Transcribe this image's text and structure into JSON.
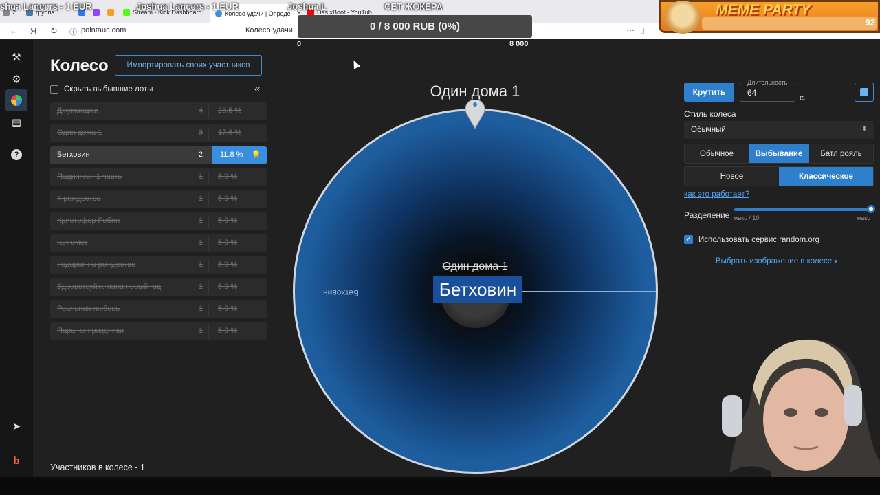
{
  "browser": {
    "tabs": [
      {
        "label": "2",
        "color": "#888"
      },
      {
        "label": "группа 1",
        "color": "#4a76a8"
      },
      {
        "label": "",
        "color": "#2c7be5"
      },
      {
        "label": "",
        "color": "#9146ff"
      },
      {
        "label": "",
        "color": "#f59d2a"
      },
      {
        "label": "Stream - Kick Dashboard",
        "color": "#53fc18"
      },
      {
        "label": "Колесо удачи | Опреде",
        "color": "#3a8ee0"
      },
      {
        "label": "Das xBoot - YouTub",
        "color": "#ff0000"
      }
    ],
    "url": "pointauc.com",
    "page_title": "Колесо удачи | О"
  },
  "overlay": {
    "donor1": "shua Lancers - 1 EUR",
    "donor2": "Joshua Lancers - 1 EUR",
    "donor3": "Joshua L",
    "set_label": "СЕТ ЖОКЕРА",
    "goal": "0 / 8 000 RUB (0%)",
    "goal_min": "0",
    "goal_max": "8 000",
    "meme_title": "MEME PARTY",
    "meme_num": "92"
  },
  "sidebar": {
    "icons": [
      "gavel-icon",
      "gear-icon",
      "wheel-icon",
      "clipboard-icon",
      "help-icon",
      "telegram-icon",
      "boosty-icon"
    ]
  },
  "left": {
    "title": "Колесо",
    "import_label": "Импортировать своих участников",
    "hide_label": "Скрыть выбывшие лоты",
    "lots": [
      {
        "name": "Джуманджи",
        "count": "4",
        "pct": "23.5 %",
        "active": false
      },
      {
        "name": "Один дома 1",
        "count": "3",
        "pct": "17.6 %",
        "active": false
      },
      {
        "name": "Бетховин",
        "count": "2",
        "pct": "11.8 %",
        "active": true
      },
      {
        "name": "Падингтон 1 часть",
        "count": "1",
        "pct": "5.9 %",
        "active": false
      },
      {
        "name": "4 рождества",
        "count": "1",
        "pct": "5.9 %",
        "active": false
      },
      {
        "name": "Кристофер Робин",
        "count": "1",
        "pct": "5.9 %",
        "active": false
      },
      {
        "name": "галгомет",
        "count": "1",
        "pct": "5.9 %",
        "active": false
      },
      {
        "name": "подарок на рождество",
        "count": "1",
        "pct": "5.9 %",
        "active": false
      },
      {
        "name": "Здравствуйте папа новый год",
        "count": "1",
        "pct": "5.9 %",
        "active": false
      },
      {
        "name": "Реальная любовь",
        "count": "1",
        "pct": "5.9 %",
        "active": false
      },
      {
        "name": "Пара на праздники",
        "count": "1",
        "pct": "5.9 %",
        "active": false
      }
    ],
    "participants": "Участников в колесе - 1"
  },
  "wheel": {
    "winner_title": "Один дома 1",
    "sector_label": "Бетховин",
    "struck_name": "Один дома 1",
    "big_name": "Бетховин"
  },
  "right": {
    "spin_label": "Крутить",
    "duration_label": "Длительность",
    "duration_value": "64",
    "duration_unit": "с.",
    "style_label": "Стиль колеса",
    "style_value": "Обычный",
    "modes": [
      "Обычное",
      "Выбывание",
      "Батл рояль"
    ],
    "active_mode": "Выбывание",
    "variants": [
      "Новое",
      "Классическое"
    ],
    "active_variant": "Классическое",
    "how_link": "как это работает?",
    "split_label": "Разделение",
    "slider_min": "макс / 10",
    "slider_max": "макс",
    "random_label": "Использовать сервис random.org",
    "image_link": "Выбрать изображение в колесе"
  }
}
